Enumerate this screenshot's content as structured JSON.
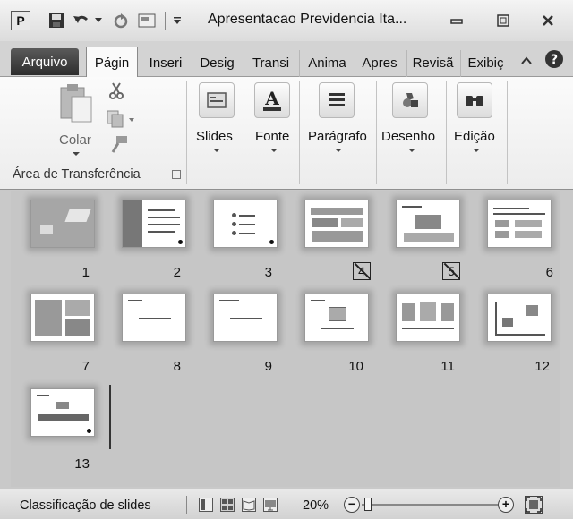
{
  "titlebar": {
    "app_icon_letter": "P",
    "document_title": "Apresentacao Previdencia Ita...",
    "minimize_label": "▭",
    "maximize_label": "▣",
    "close_label": "✕"
  },
  "tabs": [
    {
      "label": "Arquivo"
    },
    {
      "label": "Págin"
    },
    {
      "label": "Inseri"
    },
    {
      "label": "Desig"
    },
    {
      "label": "Transi"
    },
    {
      "label": "Anima"
    },
    {
      "label": "Apres"
    },
    {
      "label": "Revisã"
    },
    {
      "label": "Exibiç"
    }
  ],
  "ribbon": {
    "paste_label": "Colar",
    "clipboard_group_label": "Área de Transferência",
    "buttons": [
      {
        "label": "Slides"
      },
      {
        "label": "Fonte"
      },
      {
        "label": "Parágrafo"
      },
      {
        "label": "Desenho"
      },
      {
        "label": "Edição"
      }
    ]
  },
  "slides": [
    {
      "number": "1",
      "hidden": false
    },
    {
      "number": "2",
      "hidden": false
    },
    {
      "number": "3",
      "hidden": false
    },
    {
      "number": "4",
      "hidden": true
    },
    {
      "number": "5",
      "hidden": true
    },
    {
      "number": "6",
      "hidden": false
    },
    {
      "number": "7",
      "hidden": false
    },
    {
      "number": "8",
      "hidden": false
    },
    {
      "number": "9",
      "hidden": false
    },
    {
      "number": "10",
      "hidden": false
    },
    {
      "number": "11",
      "hidden": false
    },
    {
      "number": "12",
      "hidden": false
    },
    {
      "number": "13",
      "hidden": false
    }
  ],
  "statusbar": {
    "view_label": "Classificação de slides",
    "zoom_percent": "20%",
    "zoom_out": "−",
    "zoom_in": "+"
  }
}
